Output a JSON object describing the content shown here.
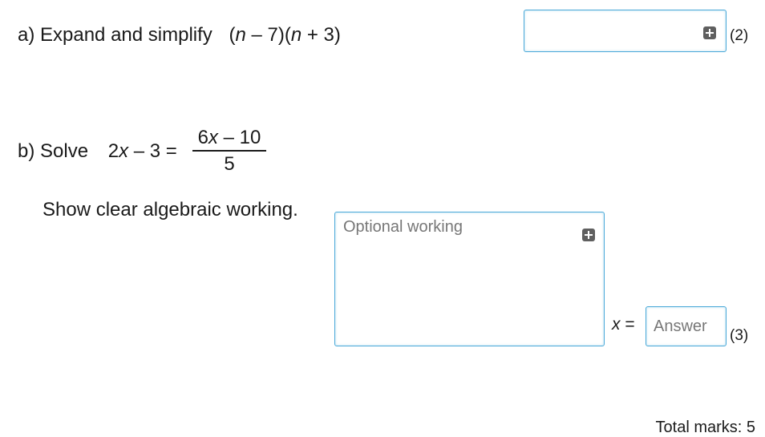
{
  "part_a": {
    "label": "a) Expand and simplify",
    "expr_open1": "(",
    "expr_n1": "n",
    "expr_mid1": " – 7)(",
    "expr_n2": "n",
    "expr_end": " + 3)",
    "marks": "(2)"
  },
  "part_b": {
    "label": "b) Solve",
    "lhs_pre": "2",
    "lhs_x": "x",
    "lhs_post": " – 3 =",
    "frac_num_pre": "6",
    "frac_num_x": "x",
    "frac_num_post": " – 10",
    "frac_den": "5",
    "instruction": "Show clear algebraic working.",
    "working_placeholder": "Optional working",
    "answer_var": "x",
    "answer_eq": " =",
    "answer_placeholder": "Answer",
    "marks": "(3)"
  },
  "footer": {
    "total_marks": "Total marks: 5"
  },
  "icons": {
    "expand": "plus-square-icon"
  },
  "colors": {
    "input_border": "#48a8d8",
    "icon_fill": "#5f5f5f"
  }
}
